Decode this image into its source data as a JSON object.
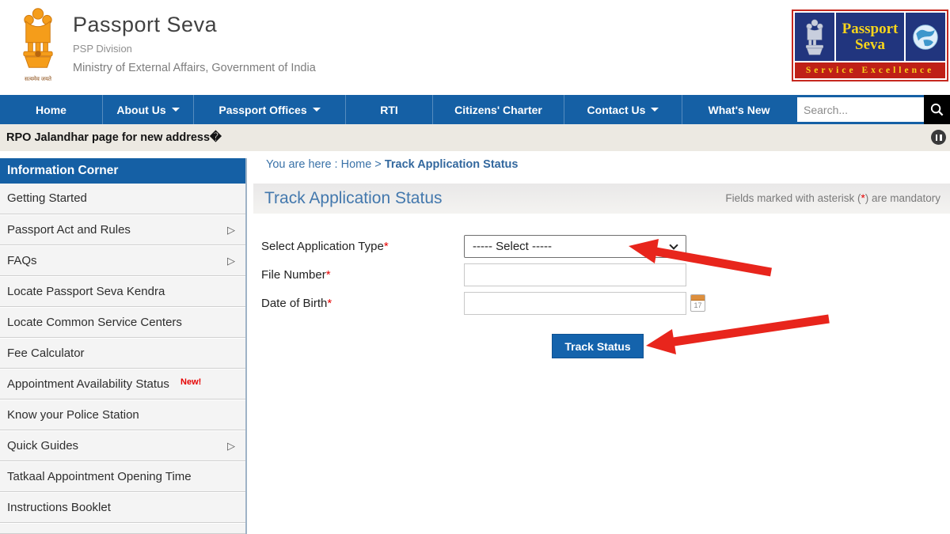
{
  "header": {
    "app_title": "Passport Seva",
    "division": "PSP Division",
    "ministry": "Ministry of External Affairs, Government of India",
    "emblem_caption": "सत्यमेव जयते",
    "badge_logo": {
      "line1": "Passport",
      "line2": "Seva",
      "band": "Service Excellence"
    }
  },
  "nav": {
    "items": [
      {
        "label": "Home",
        "has_dropdown": false
      },
      {
        "label": "About Us",
        "has_dropdown": true
      },
      {
        "label": "Passport Offices",
        "has_dropdown": true
      },
      {
        "label": "RTI",
        "has_dropdown": false
      },
      {
        "label": "Citizens' Charter",
        "has_dropdown": false
      },
      {
        "label": "Contact Us",
        "has_dropdown": true
      },
      {
        "label": "What's New",
        "has_dropdown": false
      }
    ],
    "search_placeholder": "Search..."
  },
  "ticker": {
    "text": "RPO Jalandhar page for new address�"
  },
  "sidebar": {
    "title": "Information Corner",
    "items": [
      {
        "label": "Getting Started"
      },
      {
        "label": "Passport Act and Rules",
        "expandable": true
      },
      {
        "label": "FAQs",
        "expandable": true
      },
      {
        "label": "Locate Passport Seva Kendra"
      },
      {
        "label": "Locate Common Service Centers"
      },
      {
        "label": "Fee Calculator"
      },
      {
        "label": "Appointment Availability Status",
        "badge": "New!"
      },
      {
        "label": "Know your Police Station"
      },
      {
        "label": "Quick Guides",
        "expandable": true
      },
      {
        "label": "Tatkaal Appointment Opening Time"
      },
      {
        "label": "Instructions Booklet"
      }
    ]
  },
  "main": {
    "breadcrumb": {
      "prefix": "You are here : ",
      "home": "Home",
      "separator": " > ",
      "current": "Track Application Status"
    },
    "page_title": "Track Application Status",
    "mandatory_note": {
      "pre": "Fields marked with asterisk (",
      "asterisk": "*",
      "post": ") are mandatory"
    },
    "form": {
      "application_type": {
        "label": "Select Application Type",
        "required_mark": "*",
        "value": "----- Select -----"
      },
      "file_number": {
        "label": "File Number",
        "required_mark": "*",
        "value": ""
      },
      "date_of_birth": {
        "label": "Date of Birth",
        "required_mark": "*",
        "value": "",
        "calendar_day": "17"
      },
      "submit_label": "Track Status"
    }
  },
  "colors": {
    "nav_blue": "#1560a5",
    "annotation_red": "#e8251c",
    "title_blue": "#4378ad",
    "logo_navy": "#21357e",
    "logo_red": "#bf2017",
    "logo_yellow": "#f6d41c"
  }
}
